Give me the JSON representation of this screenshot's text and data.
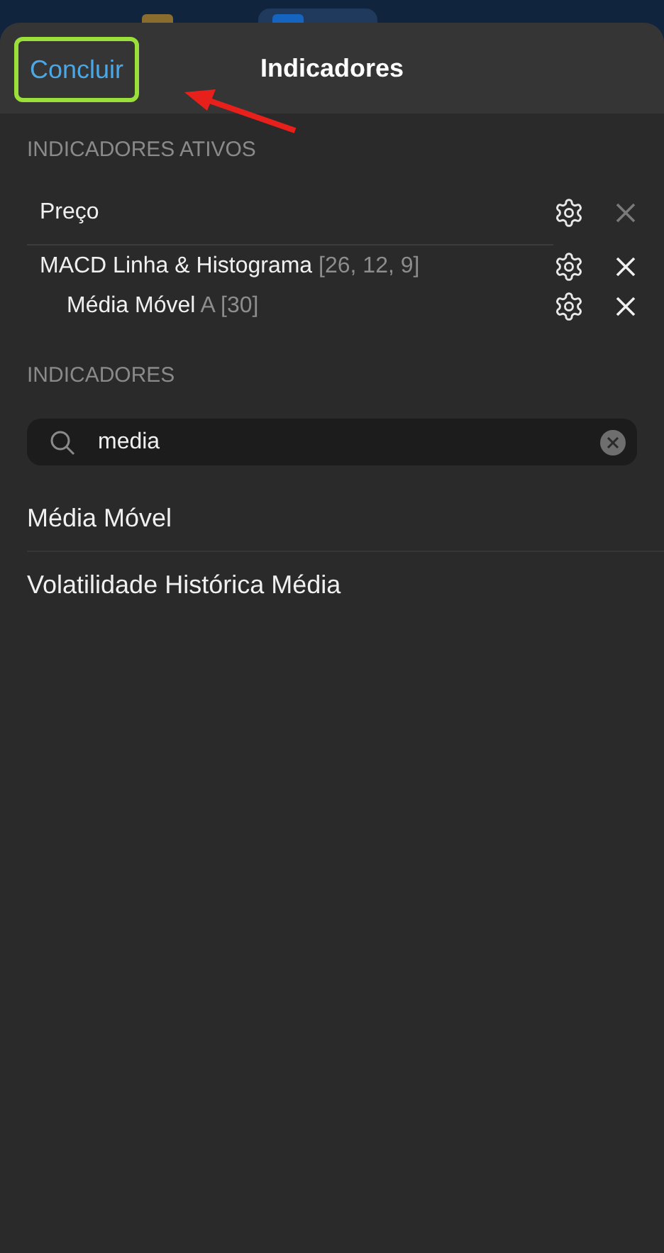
{
  "background_tabs": [
    {
      "selected": false
    },
    {
      "selected": true
    }
  ],
  "header": {
    "done_button": "Concluir",
    "title": "Indicadores",
    "highlighted": true
  },
  "active_section": {
    "heading": "INDICADORES ATIVOS",
    "items": [
      {
        "name": "Preço",
        "removable": false
      },
      {
        "name": "MACD Linha & Histograma",
        "params": "[26, 12, 9]",
        "removable": true,
        "children": [
          {
            "name": "Média Móvel",
            "params": "A [30]",
            "removable": true
          }
        ]
      }
    ]
  },
  "indicators_section": {
    "heading": "INDICADORES",
    "search": {
      "value": "media"
    },
    "results": [
      "Média Móvel",
      "Volatilidade Histórica Média"
    ]
  }
}
